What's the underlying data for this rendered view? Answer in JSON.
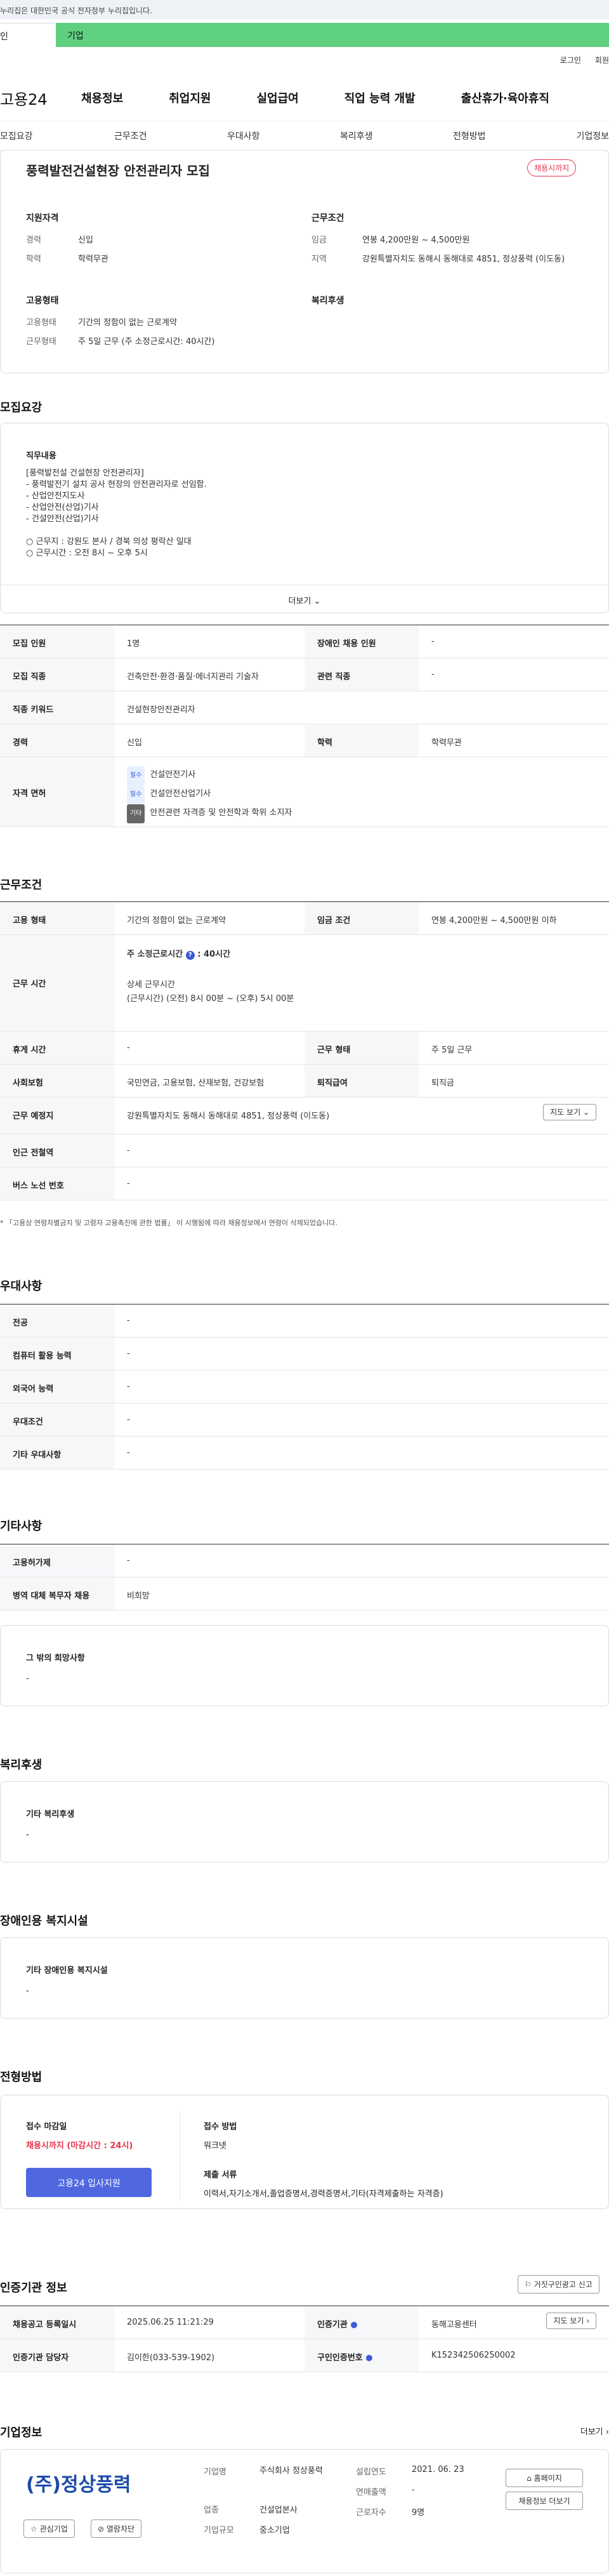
{
  "gov": {
    "notice": "누리집은 대한민국 공식 전자정부 누리집입니다.",
    "tab_a": "인",
    "tab_b": "기업"
  },
  "util": {
    "login": "로그인",
    "join": "회원"
  },
  "gnb": {
    "logo": "고용24",
    "items": [
      "채용정보",
      "취업지원",
      "실업급여",
      "직업 능력 개발",
      "출산휴가·육아휴직"
    ]
  },
  "subnav": [
    "모집요강",
    "근무조건",
    "우대사항",
    "복리후생",
    "전형방법",
    "기업정보"
  ],
  "job": {
    "title": "풍력발전건설현장 안전관리자 모집",
    "badge": "채용시까지",
    "qual_h": "지원자격",
    "career_l": "경력",
    "career_v": "신입",
    "edu_l": "학력",
    "edu_v": "학력무관",
    "cond_h": "근무조건",
    "wage_l": "임금",
    "wage_v": "연봉 4,200만원 ~ 4,500만원",
    "loc_l": "지역",
    "loc_v": "강원특별자치도 동해시 동해대로 4851, 정상풍력 (이도동)",
    "emp_h": "고용형태",
    "emp_l": "고용형태",
    "emp_v": "기간의 정함이 없는 근로계약",
    "work_l": "근무형태",
    "work_v": "주 5일 근무 (주 소정근로시간: 40시간)",
    "welfare_h": "복리후생"
  },
  "recruit": {
    "h": "모집요강",
    "duty_h": "직무내용",
    "lines": [
      "[풍력발전설 건설현장 안전관리자]",
      "- 풍력발전기 설치 공사 현장의 안전관리자로 선임함.",
      "- 산업안전지도사",
      "- 산업안전(산업)기사",
      "- 건설안전(산업)기사",
      "",
      "○ 근무지 : 강원도 본사 / 경북 의성 평락산 일대",
      "○ 근무시간 : 오전 8시 ~ 오후 5시"
    ],
    "more": "더보기"
  },
  "rt": {
    "r1": [
      "모집 인원",
      "1명",
      "장애인 채용 인원",
      "-"
    ],
    "r2": [
      "모집 직종",
      "건축안전·환경·품질·에너지관리 기술자",
      "관련 직종",
      "-"
    ],
    "r3": [
      "직종 키워드",
      "건설현장안전관리자"
    ],
    "r4": [
      "경력",
      "신입",
      "학력",
      "학력무관"
    ],
    "lic_l": "자격 면허",
    "lic_tag1": "필수",
    "lic1": "건설안전기사",
    "lic_tag2": "필수",
    "lic2": "건설안전산업기사",
    "lic_tag3": "기타",
    "lic3": "안전관련 자격증 및 안전학과 학위 소지자"
  },
  "cond": {
    "h": "근무조건",
    "r1": [
      "고용 형태",
      "기간의 정함이 없는 근로계약",
      "임금 조건",
      "연봉 4,200만원 ~ 4,500만원 이하"
    ],
    "time_l": "근무 시간",
    "time_a": "주 소정근로시간",
    "time_b": "40시간",
    "time_c": "상세 근무시간",
    "time_d": "(근무시간) (오전) 8시 00분 ~ (오후) 5시 00분",
    "r3": [
      "휴게 시간",
      "-",
      "근무 형태",
      "주 5일 근무"
    ],
    "r4": [
      "사회보험",
      "국민연금, 고용보험, 산재보험, 건강보험",
      "퇴직급여",
      "퇴직금"
    ],
    "loc_l": "근무 예정지",
    "loc_v": "강원특별자치도 동해시 동해대로 4851, 정상풍력 (이도동)",
    "map": "지도 보기",
    "r6": [
      "인근 전철역",
      "-"
    ],
    "r7": [
      "버스 노선 번호",
      "-"
    ],
    "note": "* 「고용상 연령차별금지 및 고령자 고용촉진에 관한 법률」 이 시행됨에 따라 채용정보에서 연령이 삭제되었습니다."
  },
  "pref": {
    "h": "우대사항",
    "rows": [
      [
        "전공",
        "-"
      ],
      [
        "컴퓨터 활용 능력",
        "-"
      ],
      [
        "외국어 능력",
        "-"
      ],
      [
        "우대조건",
        "-"
      ],
      [
        "기타 우대사항",
        "-"
      ]
    ]
  },
  "etc": {
    "h": "기타사항",
    "rows": [
      [
        "고용허가제",
        "-"
      ],
      [
        "병역 대체 복무자 채용",
        "비희망"
      ]
    ],
    "box_h": "그 밖의 희망사항",
    "box_v": "-"
  },
  "welfare": {
    "h": "복리후생",
    "box_h": "기타 복리후생",
    "box_v": "-"
  },
  "disab": {
    "h": "장애인용 복지시설",
    "box_h": "기타 장애인용 복지시설",
    "box_v": "-"
  },
  "proc": {
    "h": "전형방법",
    "deadline_h": "접수 마감일",
    "deadline_v": "채용시까지 (마감시간 : 24시)",
    "apply": "고용24 입사지원",
    "method_h": "접수 방법",
    "method_v": "워크넷",
    "docs_h": "제출 서류",
    "docs_v": "이력서,자기소개서,졸업증명서,경력증명서,기타(자격제출하는 자격증)"
  },
  "cert": {
    "h": "인증기관 정보",
    "report": "거짓구인광고 신고",
    "r1": [
      "채용공고 등록일시",
      "2025.06.25 11:21:29",
      "인증기관",
      "동해고용센터"
    ],
    "map": "지도 보기",
    "r2": [
      "인증기관 담당자",
      "김이한(033-539-1902)",
      "구인인증번호",
      "K152342506250002"
    ]
  },
  "company": {
    "h": "기업정보",
    "more": "더보기",
    "logo_text": "(주)정상풍력",
    "fav": "관심기업",
    "block": "열람차단",
    "name_l": "기업명",
    "name_v": "주식회사 정상풍력",
    "est_l": "설립연도",
    "est_v": "2021. 06. 23",
    "ind_l": "업종",
    "ind_v": "건설업본사",
    "rev_l": "연매출액",
    "rev_v": "-",
    "size_l": "기업규모",
    "size_v": "중소기업",
    "emp_l": "근로자수",
    "emp_v": "9명",
    "home": "홈페이지",
    "more_jobs": "채용정보 더보기"
  },
  "colors": {
    "accent": "#3a5bd9",
    "green": "#5fcf80",
    "red": "#e8344e"
  }
}
